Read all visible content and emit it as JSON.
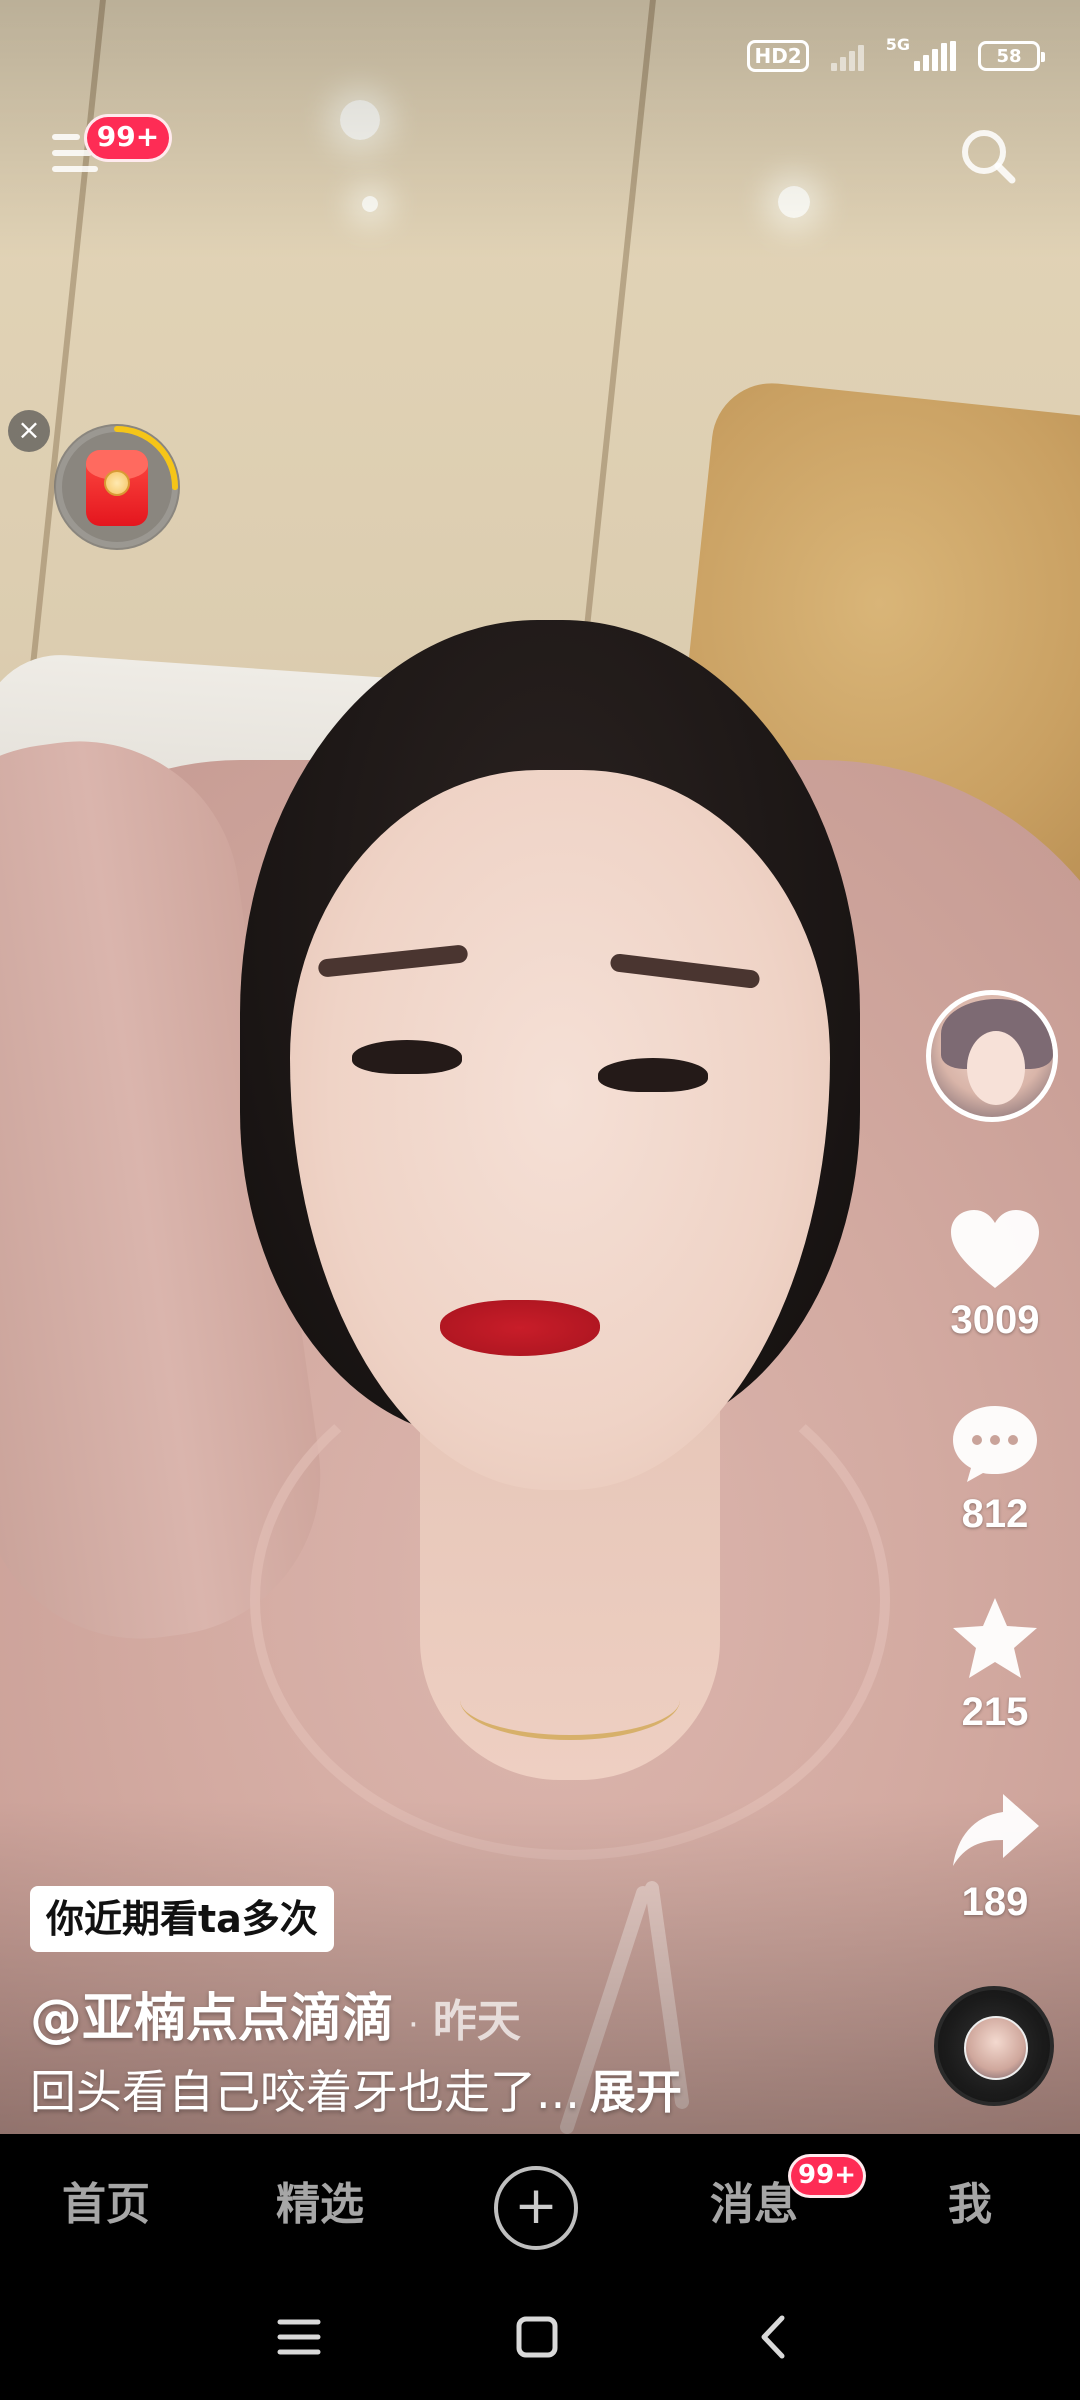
{
  "status_bar": {
    "hd_label": "HD2",
    "network_label": "5G",
    "battery_level": "58"
  },
  "top_bar": {
    "menu_badge": "99+",
    "menu_icon": "hamburger-icon",
    "search_icon": "search-icon"
  },
  "red_packet": {
    "close_glyph": "×",
    "icon": "red-envelope-icon",
    "progress": 0.25,
    "ring_color": "#f5c518"
  },
  "actions": {
    "likes": "3009",
    "comments": "812",
    "favorites": "215",
    "shares": "189"
  },
  "caption": {
    "tag": "你近期看ta多次",
    "author": "@亚楠点点滴滴",
    "separator": "·",
    "time": "昨天",
    "description": "回头看自己咬着牙也走了...",
    "expand": "展开"
  },
  "bottom_nav": {
    "home": "首页",
    "featured": "精选",
    "create": "+",
    "messages": "消息",
    "messages_badge": "99+",
    "me": "我"
  },
  "colors": {
    "badge": "#fe2c55",
    "nav_background": "#000000"
  }
}
